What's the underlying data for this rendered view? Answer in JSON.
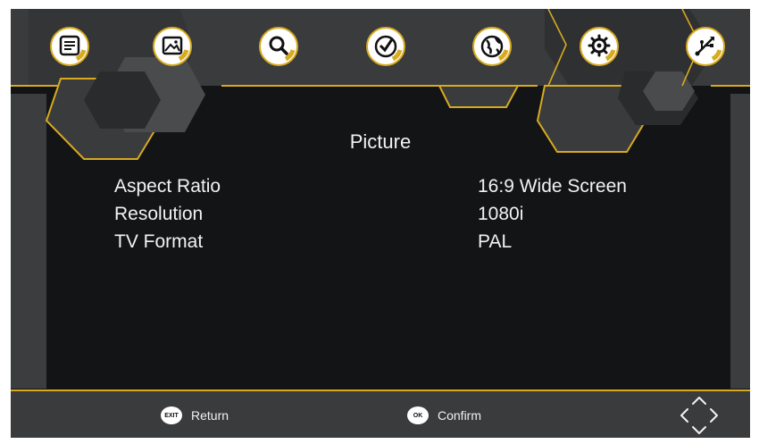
{
  "menu": {
    "items": [
      {
        "name": "program-icon"
      },
      {
        "name": "picture-icon"
      },
      {
        "name": "search-icon"
      },
      {
        "name": "time-icon"
      },
      {
        "name": "globe-icon"
      },
      {
        "name": "settings-gear-icon"
      },
      {
        "name": "usb-icon"
      }
    ],
    "active_index": 1
  },
  "page": {
    "title": "Picture"
  },
  "settings": [
    {
      "label": "Aspect Ratio",
      "value": "16:9 Wide Screen"
    },
    {
      "label": "Resolution",
      "value": "1080i"
    },
    {
      "label": "TV Format",
      "value": "PAL"
    }
  ],
  "footer": {
    "exit_key": "EXIT",
    "return_label": "Return",
    "ok_key": "OK",
    "confirm_label": "Confirm"
  },
  "colors": {
    "accent": "#d7aa20",
    "background": "#131416",
    "panel": "#3a3b3d",
    "text": "#f2f2f2"
  }
}
